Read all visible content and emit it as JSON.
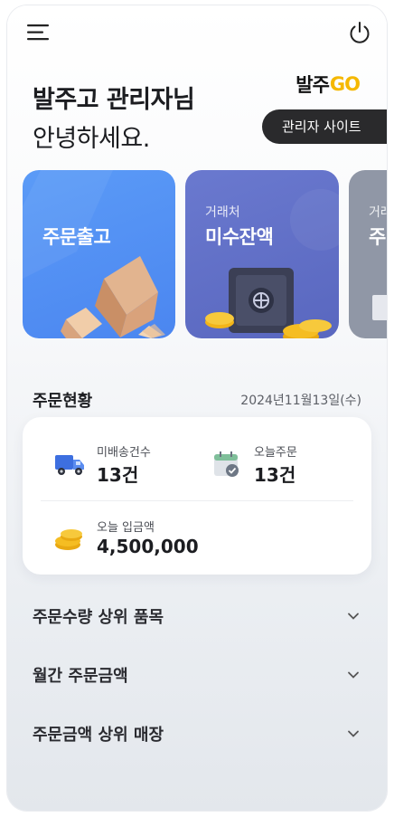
{
  "header": {
    "greeting_line1": "발주고 관리자님",
    "greeting_line2": "안녕하세요.",
    "logo_text": "발주",
    "logo_accent": "GO",
    "admin_site_button": "관리자 사이트"
  },
  "cards": [
    {
      "subtitle": "",
      "title": "주문출고",
      "color": "#5591f5"
    },
    {
      "subtitle": "거래처",
      "title": "미수잔액",
      "color": "#6270c8"
    },
    {
      "subtitle": "거래",
      "title": "주",
      "color": "#9097a6"
    }
  ],
  "order_status": {
    "title": "주문현황",
    "date": "2024년11월13일(수)",
    "items": [
      {
        "label": "미배송건수",
        "value": "13건",
        "icon": "delivery-truck-icon"
      },
      {
        "label": "오늘주문",
        "value": "13건",
        "icon": "calendar-check-icon"
      },
      {
        "label": "오늘 입금액",
        "value": "4,500,000",
        "icon": "coins-icon"
      }
    ]
  },
  "accordions": [
    {
      "title": "주문수량 상위 품목"
    },
    {
      "title": "월간 주문금액"
    },
    {
      "title": "주문금액 상위 매장"
    }
  ],
  "colors": {
    "accent_yellow": "#f5b800",
    "dark_button": "#2a2a2c",
    "card_blue": "#5591f5",
    "card_indigo": "#6270c8"
  }
}
